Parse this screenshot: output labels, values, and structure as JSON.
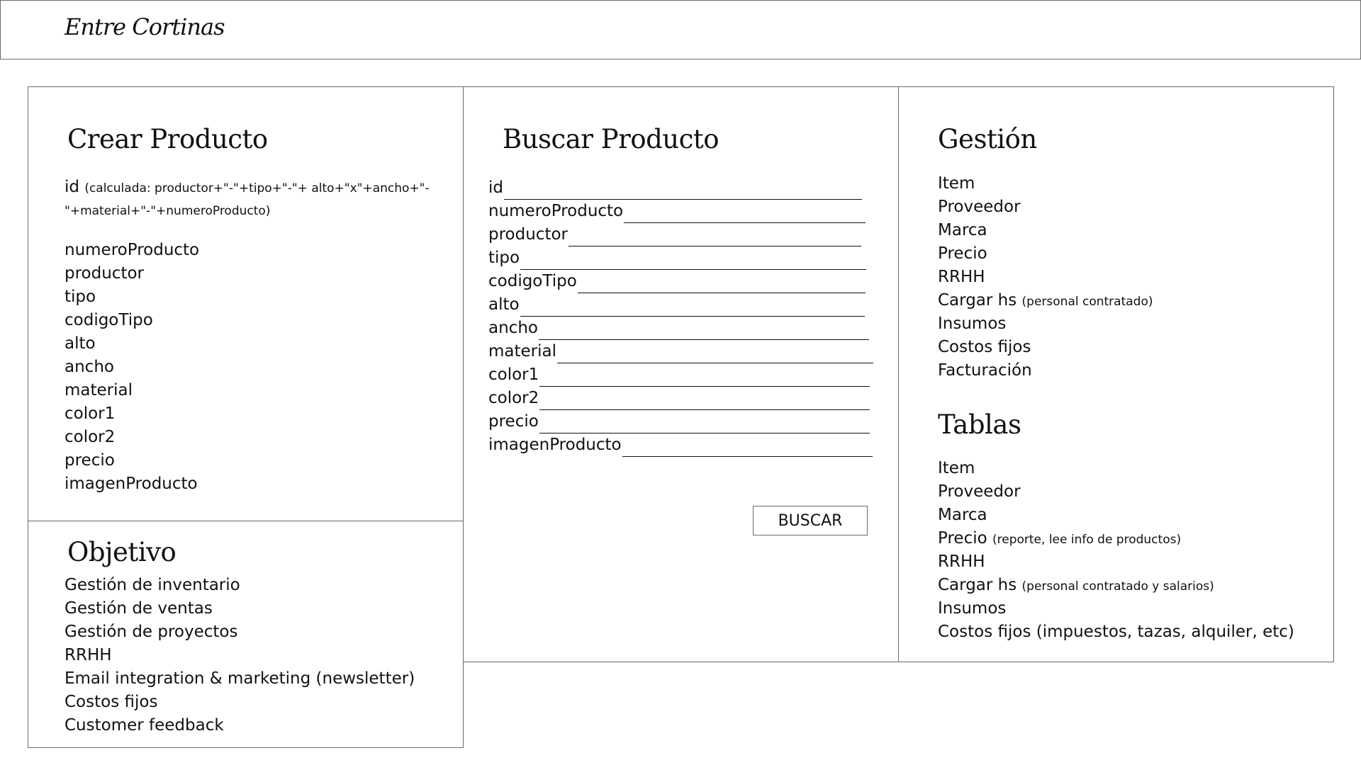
{
  "header": {
    "logo_text": "Entre Cortinas"
  },
  "crear": {
    "title": "Crear Producto",
    "id_label": "id",
    "id_note": "(calculada: productor+\"-\"+tipo+\"-\"+ alto+\"x\"+ancho+\"-\"+material+\"-\"+numeroProducto)",
    "fields": [
      "numeroProducto",
      "productor",
      "tipo",
      "codigoTipo",
      "alto",
      "ancho",
      "material",
      "color1",
      "color2",
      "precio",
      "imagenProducto"
    ]
  },
  "buscar": {
    "title": "Buscar Producto",
    "fields": [
      "id",
      "numeroProducto",
      "productor",
      "tipo",
      "codigoTipo",
      "alto",
      "ancho",
      "material",
      "color1",
      "color2",
      "precio",
      "imagenProducto"
    ],
    "button_label": "BUSCAR"
  },
  "gestion": {
    "title": "Gestión",
    "items": [
      {
        "label": "Item",
        "note": ""
      },
      {
        "label": "Proveedor",
        "note": ""
      },
      {
        "label": "Marca",
        "note": ""
      },
      {
        "label": "Precio",
        "note": ""
      },
      {
        "label": "RRHH",
        "note": ""
      },
      {
        "label": "Cargar hs",
        "note": "(personal contratado)"
      },
      {
        "label": "Insumos",
        "note": ""
      },
      {
        "label": "Costos fijos",
        "note": ""
      },
      {
        "label": "Facturación",
        "note": ""
      }
    ]
  },
  "tablas": {
    "title": "Tablas",
    "items": [
      {
        "label": "Item",
        "note": ""
      },
      {
        "label": "Proveedor",
        "note": ""
      },
      {
        "label": "Marca",
        "note": ""
      },
      {
        "label": "Precio",
        "note": "(reporte, lee info de productos)"
      },
      {
        "label": "RRHH",
        "note": ""
      },
      {
        "label": "Cargar hs",
        "note": "(personal contratado y salarios)"
      },
      {
        "label": "Insumos",
        "note": ""
      },
      {
        "label": "Costos fijos (impuestos, tazas, alquiler, etc)",
        "note": ""
      }
    ]
  },
  "objetivo": {
    "title": "Objetivo",
    "items": [
      "Gestión de inventario",
      "Gestión de ventas",
      "Gestión de proyectos",
      "RRHH",
      "Email integration & marketing (newsletter)",
      "Costos fijos",
      "Customer feedback"
    ]
  }
}
